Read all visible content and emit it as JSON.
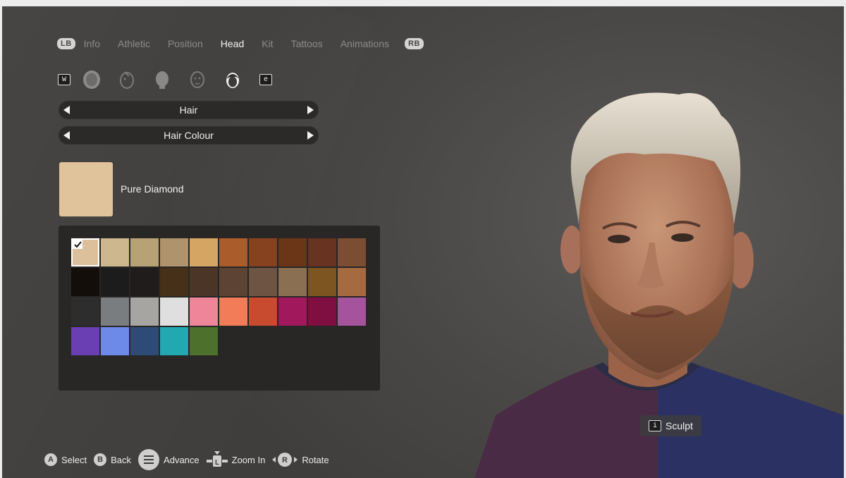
{
  "tabs": {
    "left_bumper": "LB",
    "right_bumper": "RB",
    "items": [
      "Info",
      "Athletic",
      "Position",
      "Head",
      "Kit",
      "Tattoos",
      "Animations"
    ],
    "active": "Head"
  },
  "category_icons": {
    "left_key": "W",
    "right_key": "e",
    "icons": [
      "head-shape-icon",
      "face-sculpt-icon",
      "skin-icon",
      "face-features-icon",
      "hair-icon"
    ],
    "active": "hair-icon"
  },
  "selectors": {
    "hair_label": "Hair",
    "colour_label": "Hair Colour"
  },
  "current_colour": {
    "name": "Pure Diamond",
    "hex": "#e0c39b"
  },
  "palette": {
    "selected_index": 0,
    "colors": [
      "#dcc09b",
      "#cdb78e",
      "#b6a274",
      "#ae936c",
      "#d5a564",
      "#aa5d2a",
      "#86411f",
      "#6b3517",
      "#693322",
      "#7b4d33",
      "#140e0a",
      "#1c1c1c",
      "#201c1c",
      "#463018",
      "#4a3527",
      "#5c4333",
      "#6d5443",
      "#8a6f52",
      "#7c5520",
      "#a66a41",
      "#2d2d2d",
      "#7a7d7f",
      "#a7a5a2",
      "#dfdfdf",
      "#ee8599",
      "#f27b58",
      "#c84a2f",
      "#a1195c",
      "#7f0f40",
      "#a5539d",
      "#6a3fb3",
      "#6e8ae8",
      "#2d4b76",
      "#22a8b0",
      "#4d702c"
    ]
  },
  "sculpt": {
    "key": "i",
    "label": "Sculpt"
  },
  "hints": [
    {
      "button": "A",
      "label": "Select"
    },
    {
      "button": "B",
      "label": "Back"
    },
    {
      "button": "menu",
      "label": "Advance"
    },
    {
      "button": "L",
      "label": "Zoom In"
    },
    {
      "button": "R",
      "label": "Rotate"
    }
  ]
}
